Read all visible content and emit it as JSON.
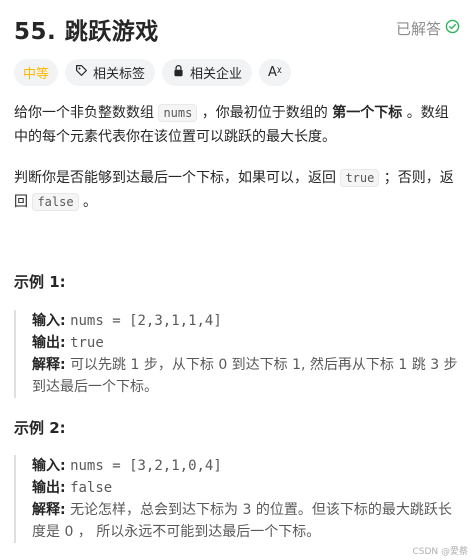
{
  "header": {
    "title": "55. 跳跃游戏",
    "status": "已解答"
  },
  "tags": {
    "difficulty": "中等",
    "related_tags": "相关标签",
    "related_companies": "相关企业",
    "font_toggle": "Aᵡ"
  },
  "description": {
    "p1_a": "给你一个非负整数数组 ",
    "p1_code": "nums",
    "p1_b": " ，你最初位于数组的 ",
    "p1_bold": "第一个下标",
    "p1_c": " 。数组中的每个元素代表你在该位置可以跳跃的最大长度。",
    "p2_a": "判断你是否能够到达最后一个下标，如果可以，返回 ",
    "p2_code1": "true",
    "p2_b": " ；否则，返回 ",
    "p2_code2": "false",
    "p2_c": " 。"
  },
  "examples": [
    {
      "title": "示例 1:",
      "input_label": "输入:",
      "input": "nums = [2,3,1,1,4]",
      "output_label": "输出:",
      "output": "true",
      "explain_label": "解释:",
      "explain": "可以先跳 1 步，从下标 0 到达下标 1, 然后再从下标 1 跳 3 步到达最后一个下标。"
    },
    {
      "title": "示例 2:",
      "input_label": "输入:",
      "input": "nums = [3,2,1,0,4]",
      "output_label": "输出:",
      "output": "false",
      "explain_label": "解释:",
      "explain": "无论怎样，总会到达下标为 3 的位置。但该下标的最大跳跃长度是 0 ， 所以永远不可能到达最后一个下标。"
    }
  ],
  "watermark": "CSDN @愛蔡",
  "colors": {
    "medium": "#ffb800",
    "solved_check": "#2db55d"
  }
}
